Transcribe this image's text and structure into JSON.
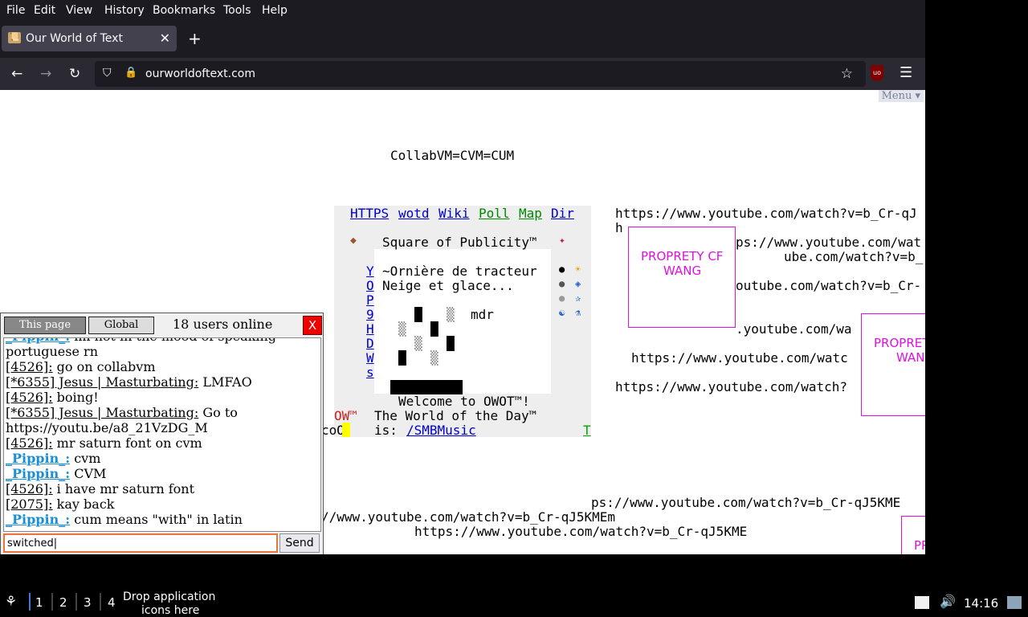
{
  "menubar": [
    "File",
    "Edit",
    "View",
    "History",
    "Bookmarks",
    "Tools",
    "Help"
  ],
  "tab": {
    "title": "Our World of Text"
  },
  "url": "ourworldoftext.com",
  "page": {
    "menu_label": "Menu",
    "header_text": "CollabVM=CVM=CUM",
    "nav_links": [
      "HTTPS",
      "wotd",
      "Wiki",
      "Poll",
      "Map",
      "Dir"
    ],
    "square_title": "Square of Publicity™",
    "left_letters": [
      "Y",
      "O",
      "P",
      "9",
      "H",
      "D",
      "W",
      "s"
    ],
    "inner_lines": [
      "~Ornière de tracteur",
      "Neige et glace..."
    ],
    "mdr": "mdr",
    "welcome": "Welcome to OWOT™!",
    "wotd_line1": "The World of the Day™",
    "wotd_prefix": "is: ",
    "wotd_link": "/SMBMusic",
    "ow_text": "OW™",
    "coo_text": "coO",
    "t_link": "T",
    "yt_lines": [
      "https://www.youtube.com/watch?v=b_Cr-qJ",
      "h",
      "ps://www.youtube.com/wat",
      "ube.com/watch?v=b_",
      "outube.com/watch?v=b_Cr-",
      ".youtube.com/wa",
      "https://www.youtube.com/watc",
      "https://www.youtube.com/watch?",
      "ps://www.youtube.com/watch?v=b_Cr-qJ5KME",
      "//www.youtube.com/watch?v=b_Cr-qJ5KMEm",
      "https://www.youtube.com/watch?v=b_Cr-qJ5KME"
    ],
    "proprety_box1": [
      "PROPRETY CF",
      "WANG"
    ],
    "proprety_box2": [
      "PROPRET",
      "WAN"
    ],
    "pr_fragment": "PR"
  },
  "chat": {
    "tab_this_page": "This page",
    "tab_global": "Global",
    "users_online": "18 users online",
    "close": "X",
    "messages": [
      {
        "nick": "_Pippin_:",
        "pip": true,
        "text": " im not in the mood of speaking"
      },
      {
        "nick": "",
        "pip": false,
        "text": "portuguese rn"
      },
      {
        "nick": "[4526]:",
        "pip": false,
        "text": " go on collabvm"
      },
      {
        "nick": "[*6355] Jesus | Masturbating:",
        "pip": false,
        "text": " LMFAO"
      },
      {
        "nick": "[4526]:",
        "pip": false,
        "text": " boing!"
      },
      {
        "nick": "[*6355] Jesus | Masturbating:",
        "pip": false,
        "text": " Go to"
      },
      {
        "nick": "",
        "pip": false,
        "text": "https://youtu.be/a8_21VzDG_M"
      },
      {
        "nick": "[4526]:",
        "pip": false,
        "text": " mr saturn font on cvm"
      },
      {
        "nick": "_Pippin_:",
        "pip": true,
        "text": " cvm"
      },
      {
        "nick": "_Pippin_:",
        "pip": true,
        "text": " CVM"
      },
      {
        "nick": "[4526]:",
        "pip": false,
        "text": " i have mr saturn font"
      },
      {
        "nick": "[2075]:",
        "pip": false,
        "text": " kay back"
      },
      {
        "nick": "_Pippin_:",
        "pip": true,
        "text": " cum means \"with\" in latin"
      }
    ],
    "input_value": "switched",
    "send_label": "Send"
  },
  "taskbar": {
    "workspaces": [
      "1",
      "2",
      "3",
      "4"
    ],
    "drop_text_1": "Drop application",
    "drop_text_2": "icons here",
    "clock": "14:16"
  }
}
